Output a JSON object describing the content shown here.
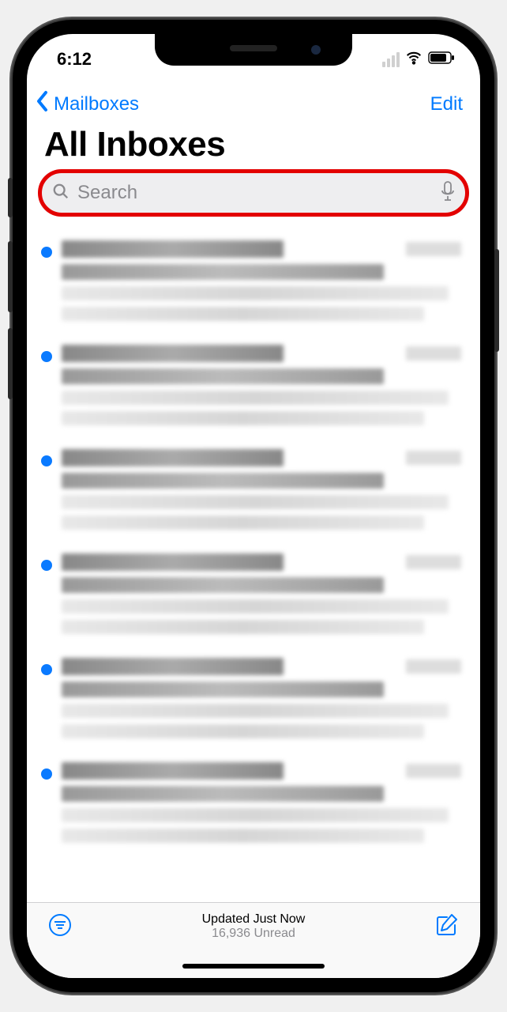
{
  "statusBar": {
    "time": "6:12"
  },
  "nav": {
    "back_label": "Mailboxes",
    "edit_label": "Edit"
  },
  "title": "All Inboxes",
  "search": {
    "placeholder": "Search"
  },
  "emails": [
    {
      "unread": true
    },
    {
      "unread": true
    },
    {
      "unread": true
    },
    {
      "unread": true
    },
    {
      "unread": true
    },
    {
      "unread": true
    }
  ],
  "toolbar": {
    "status": "Updated Just Now",
    "substatus": "16,936 Unread"
  }
}
